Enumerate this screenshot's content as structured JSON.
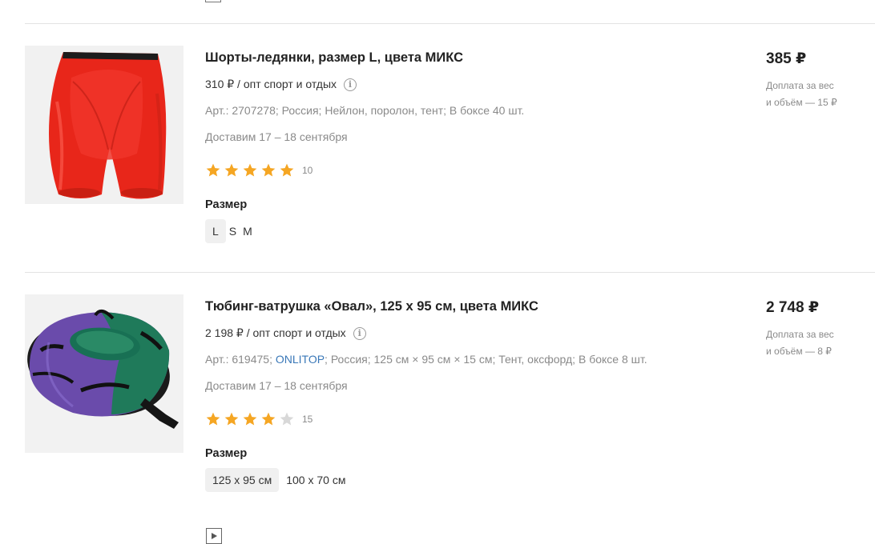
{
  "products": [
    {
      "title": "Шорты-ледянки, размер L, цвета МИКС",
      "wholesale": "310 ₽ / опт спорт и отдых",
      "article_label": "Арт.: 2707278;",
      "brand": "",
      "attrs_rest": "Россия;  Нейлон, поролон, тент;  В боксе 40 шт.",
      "delivery": "Доставим 17 – 18 сентября",
      "rating": 5,
      "rating_count": "10",
      "size_label": "Размер",
      "sizes": [
        "L",
        "S",
        "M"
      ],
      "selected_size": "L",
      "price": "385 ₽",
      "surcharge_line1": "Доплата за вес",
      "surcharge_line2": "и объём — 15 ₽"
    },
    {
      "title": "Тюбинг-ватрушка «Овал», 125 x 95 см, цвета МИКС",
      "wholesale": "2 198 ₽ / опт спорт и отдых",
      "article_label": "Арт.: 619475;",
      "brand": "ONLITOP",
      "attrs_rest": ";  Россия;  125 см × 95 см × 15 см;  Тент, оксфорд;  В боксе 8 шт.",
      "delivery": "Доставим 17 – 18 сентября",
      "rating": 4,
      "rating_count": "15",
      "size_label": "Размер",
      "sizes": [
        "125 x 95 см",
        "100 x 70 см"
      ],
      "selected_size": "125 x 95 см",
      "price": "2 748 ₽",
      "surcharge_line1": "Доплата за вес",
      "surcharge_line2": "и объём — 8 ₽"
    }
  ],
  "colors": {
    "star_filled": "#f5a623",
    "star_empty": "#d8d8d8",
    "brand_link": "#3a78b8"
  }
}
